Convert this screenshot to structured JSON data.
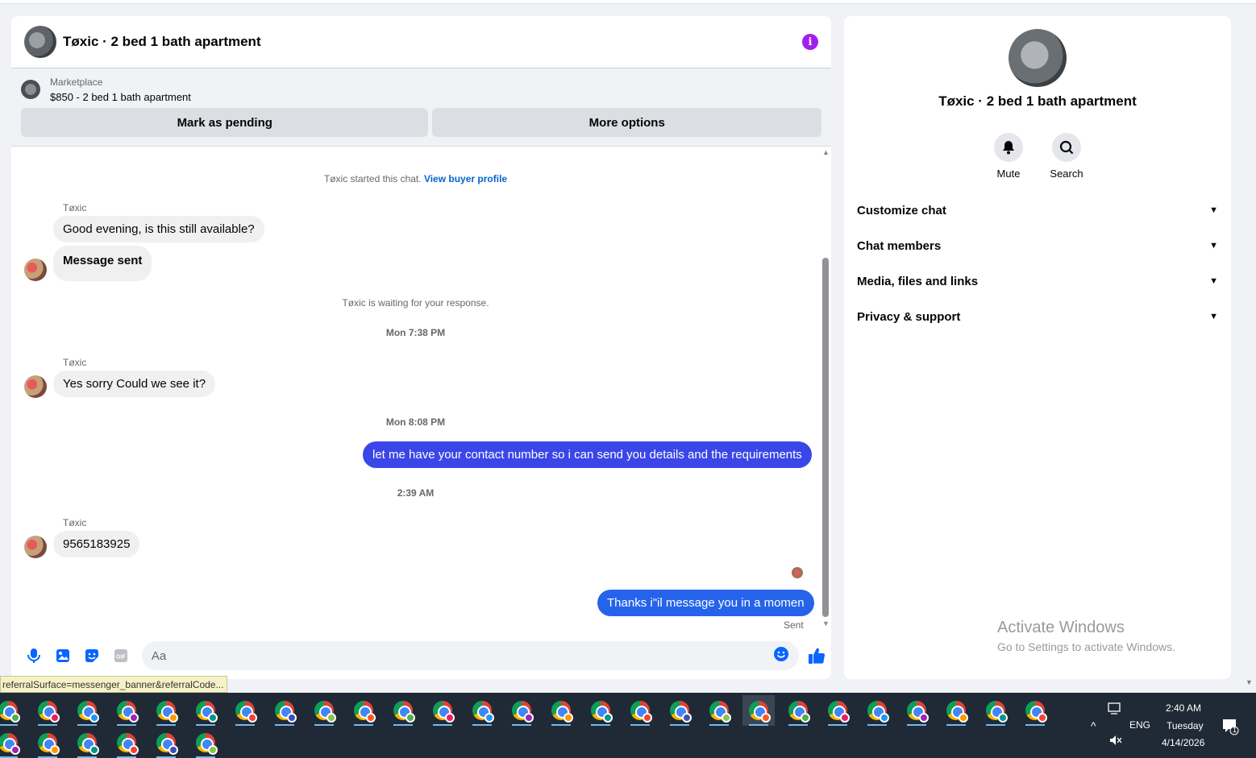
{
  "chat": {
    "title": "Tøxic · 2 bed 1 bath apartment",
    "marketplace_label": "Marketplace",
    "listing": "$850 - 2 bed 1 bath apartment",
    "btn_pending": "Mark as pending",
    "btn_more": "More options",
    "started_text": "Tøxic started this chat.",
    "view_buyer": "View buyer profile",
    "waiting_text": "Tøxic is waiting for your response.",
    "sender_name": "Tøxic",
    "ts1": "Mon 7:38 PM",
    "ts2": "Mon 8:08 PM",
    "ts3": "2:39 AM",
    "msg1": "Good evening, is this still available?",
    "msg2": "Message sent",
    "msg3": "Yes sorry Could we see it?",
    "msg4": "let me have your contact number so i can send you details and the requirements",
    "msg5": "9565183925",
    "msg6": "Thanks i\"il message you in a momen",
    "sent_label": "Sent",
    "input_placeholder": "Aa"
  },
  "side": {
    "title": "Tøxic · 2 bed 1 bath apartment",
    "mute": "Mute",
    "search": "Search",
    "acc1": "Customize chat",
    "acc2": "Chat members",
    "acc3": "Media, files and links",
    "acc4": "Privacy & support"
  },
  "watermark": {
    "line1": "Activate Windows",
    "line2": "Go to Settings to activate Windows."
  },
  "status_url": "referralSurface=messenger_banner&referralCode...",
  "taskbar": {
    "time": "2:40 AM",
    "day": "Tuesday",
    "date": "4/14/2026",
    "lang": "ENG",
    "notif_count": "1"
  },
  "colors": {
    "accent": "#0064d1",
    "out_bubble": "#3b46e8",
    "info": "#a020f0"
  }
}
